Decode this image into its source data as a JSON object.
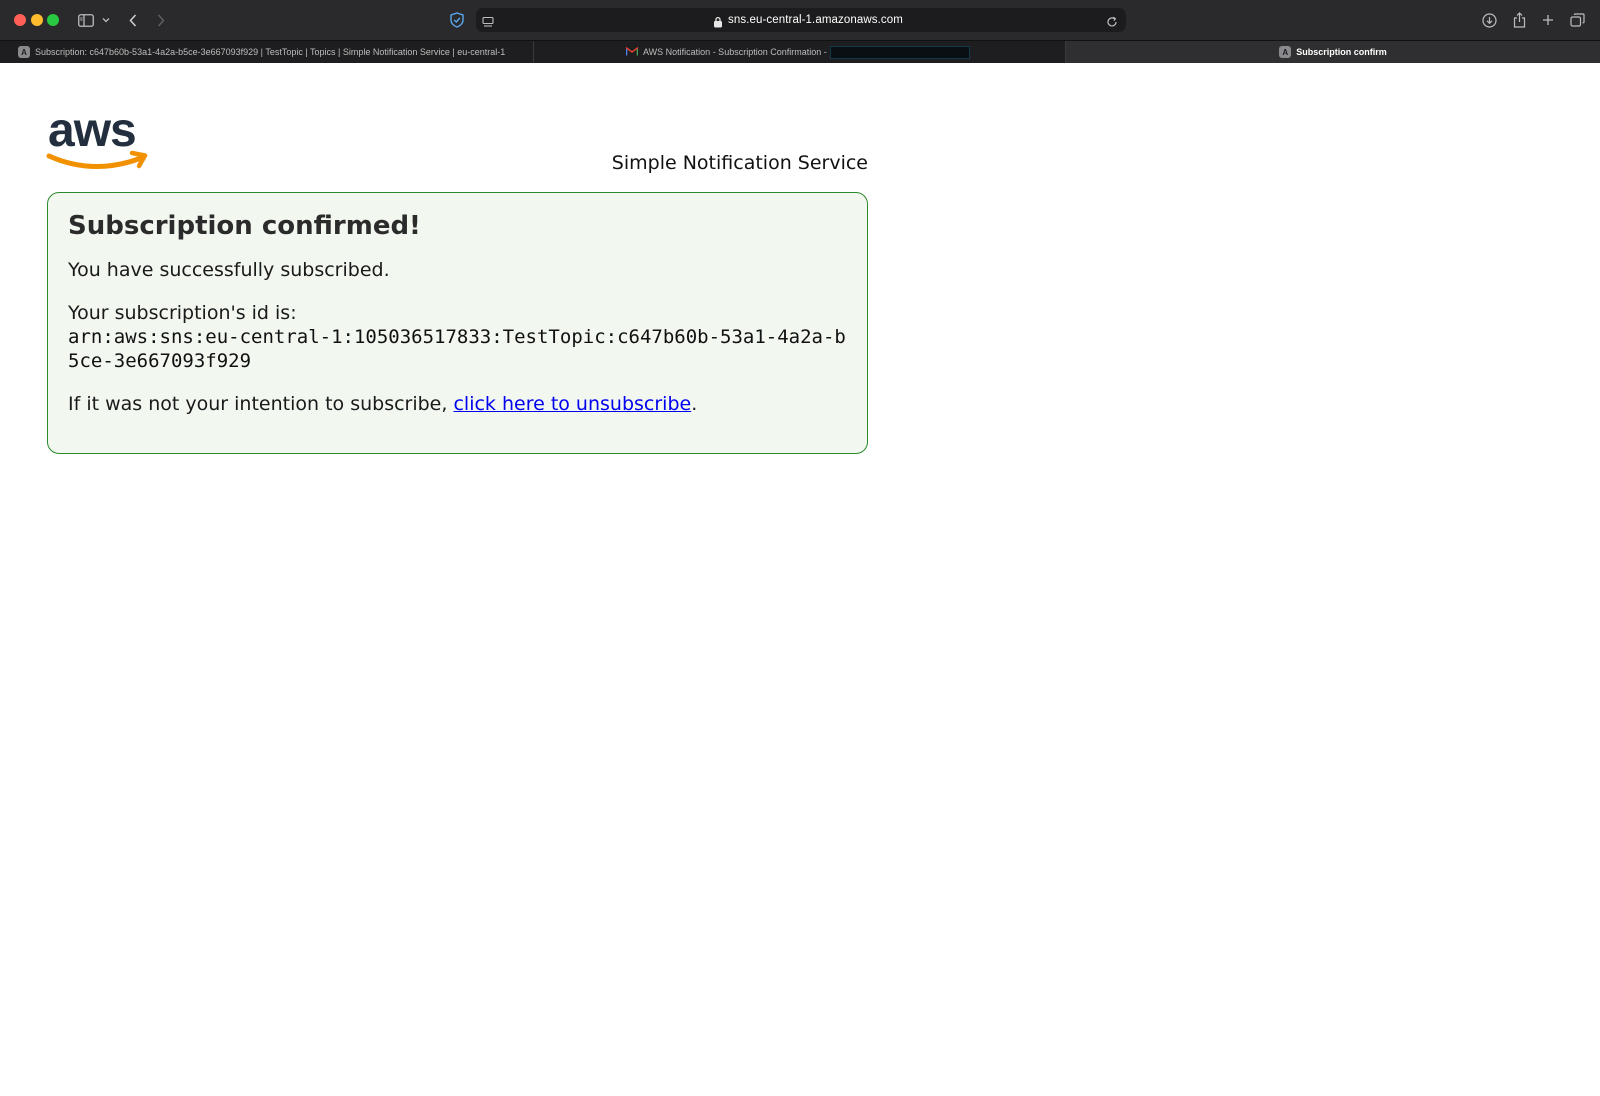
{
  "browser": {
    "url": "sns.eu-central-1.amazonaws.com",
    "tabs": [
      {
        "label": "Subscription: c647b60b-53a1-4a2a-b5ce-3e667093f929 | TestTopic | Topics | Simple Notification Service | eu-central-1",
        "favicon": "A",
        "active": false
      },
      {
        "label": "AWS Notification - Subscription Confirmation -",
        "favicon": "gmail-icon",
        "active": false
      },
      {
        "label": "Subscription confirm",
        "favicon": "A",
        "active": true
      }
    ]
  },
  "header": {
    "logo_text": "aws",
    "service_name": "Simple Notification Service"
  },
  "confirmation": {
    "title": "Subscription confirmed!",
    "success_message": "You have successfully subscribed.",
    "id_label": "Your subscription's id is:",
    "subscription_arn": "arn:aws:sns:eu-central-1:105036517833:TestTopic:c647b60b-53a1-4a2a-b5ce-3e667093f929",
    "unsubscribe_prefix": "If it was not your intention to subscribe, ",
    "unsubscribe_link": "click here to unsubscribe",
    "unsubscribe_suffix": "."
  },
  "colors": {
    "card_border": "#2a8a2a",
    "card_background": "#f2f7f0",
    "link": "#0000ee",
    "aws_smile": "#f29100"
  }
}
